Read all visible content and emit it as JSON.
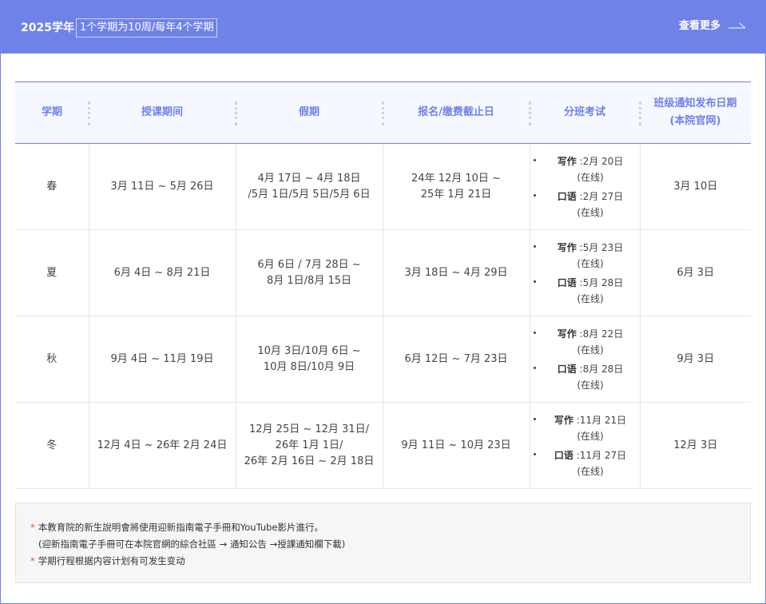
{
  "header": {
    "year": "2025学年",
    "badge": "1个学期为10周/每年4个学期",
    "more_label": "查看更多"
  },
  "table": {
    "columns": [
      "学期",
      "授课期间",
      "假期",
      "报名/缴费截止日",
      "分班考试",
      "班级通知发布日期\n(本院官网)"
    ],
    "rows": [
      {
        "term": "春",
        "period": "3月 11日 ~ 5月 26日",
        "holiday": "4月 17日 ~ 4月 18日\n/5月 1日/5月 5日/5月 6日",
        "deadline": "24年 12月 10日 ~\n25年 1月 21日",
        "exam": [
          {
            "label": "写作",
            "date": " :2月 20日",
            "mode": "(在线)"
          },
          {
            "label": "口语",
            "date": " :2月 27日",
            "mode": "(在线)"
          }
        ],
        "notice": "3月 10日"
      },
      {
        "term": "夏",
        "period": "6月 4日 ~ 8月 21日",
        "holiday": "6月 6日 / 7月 28日 ~\n8月 1日/8月 15日",
        "deadline": "3月 18日 ~ 4月 29日",
        "exam": [
          {
            "label": "写作",
            "date": " :5月 23日",
            "mode": "(在线)"
          },
          {
            "label": "口语",
            "date": " :5月 28日",
            "mode": "(在线)"
          }
        ],
        "notice": "6月 3日"
      },
      {
        "term": "秋",
        "period": "9月 4日 ~ 11月 19日",
        "holiday": "10月 3日/10月 6日 ~\n10月 8日/10月 9日",
        "deadline": "6月 12日 ~ 7月 23日",
        "exam": [
          {
            "label": "写作",
            "date": " :8月 22日",
            "mode": "(在线)"
          },
          {
            "label": "口语",
            "date": " :8月 28日",
            "mode": "(在线)"
          }
        ],
        "notice": "9月 3日"
      },
      {
        "term": "冬",
        "period": "12月 4日 ~ 26年 2月 24日",
        "holiday": "12月 25日 ~ 12月 31日/\n26年 1月 1日/\n26年 2月 16日 ~ 2月 18日",
        "deadline": "9月 11日 ~ 10月 23日",
        "exam": [
          {
            "label": "写作",
            "date": " :11月 21日",
            "mode": "(在线)"
          },
          {
            "label": "口语",
            "date": " :11月 27日",
            "mode": "(在线)"
          }
        ],
        "notice": "12月 3日"
      }
    ]
  },
  "notes": {
    "star": "*",
    "line1": "本教育院的新生說明會將使用迎新指南電子手冊和YouTube影片進行。",
    "line2": "(迎新指南電子手冊可在本院官網的綜合社區 → 通知公告 →授課通知欄下載)",
    "line3": "学期行程根据内容计划有可发生变动"
  },
  "colors": {
    "accent": "#6f82e8",
    "header_row_bg": "#f6f8ff",
    "star": "#e8531f",
    "notes_bg": "#f6f6f6"
  },
  "icons": {
    "more": "arrow-right-icon",
    "bullet": "bullet-dot-icon"
  }
}
